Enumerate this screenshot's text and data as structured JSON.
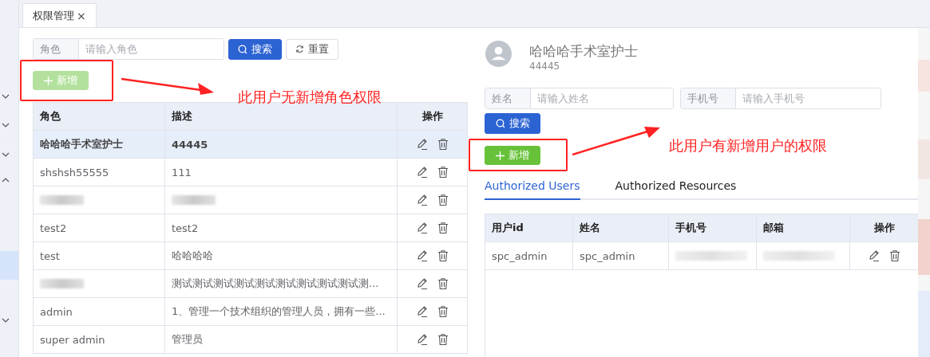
{
  "sidebar": {
    "items": [
      {
        "expanded": false
      },
      {
        "expanded": false
      },
      {
        "expanded": false
      },
      {
        "expanded": true
      },
      {
        "expanded": false
      }
    ]
  },
  "tabs": [
    {
      "label": "权限管理",
      "close": "×",
      "selected": true
    }
  ],
  "roles_panel": {
    "search": {
      "label": "角色",
      "placeholder": "请输入角色"
    },
    "search_button": "搜索",
    "reset_button": "重置",
    "add_button": {
      "label": "新增",
      "disabled": true
    },
    "table": {
      "columns": [
        "角色",
        "描述",
        "操作"
      ],
      "rows": [
        {
          "selected": true,
          "role": {
            "kind": "text",
            "text": "哈哈哈手术室护士"
          },
          "description": {
            "kind": "text",
            "text": "44445"
          }
        },
        {
          "selected": false,
          "role": {
            "kind": "text",
            "text": "shshsh55555"
          },
          "description": {
            "kind": "text",
            "text": "111"
          }
        },
        {
          "selected": false,
          "role": {
            "kind": "blurred"
          },
          "description": {
            "kind": "blurred"
          }
        },
        {
          "selected": false,
          "role": {
            "kind": "text",
            "text": "test2"
          },
          "description": {
            "kind": "text",
            "text": "test2"
          }
        },
        {
          "selected": false,
          "role": {
            "kind": "text",
            "text": "test"
          },
          "description": {
            "kind": "text",
            "text": "哈哈哈哈"
          }
        },
        {
          "selected": false,
          "role": {
            "kind": "blurred"
          },
          "description": {
            "kind": "text",
            "text": "测试测试测试测试测试测试测试测试测试测..."
          }
        },
        {
          "selected": false,
          "role": {
            "kind": "text",
            "text": "admin"
          },
          "description": {
            "kind": "text",
            "text": "1、管理一个技术组织的管理人员，拥有一些..."
          }
        },
        {
          "selected": false,
          "role": {
            "kind": "text",
            "text": "super admin"
          },
          "description": {
            "kind": "text",
            "text": "管理员"
          }
        }
      ]
    }
  },
  "role_detail": {
    "name": "哈哈哈手术室护士",
    "description": "44445",
    "fields": [
      {
        "label": "姓名",
        "placeholder": "请输入姓名"
      },
      {
        "label": "手机号",
        "placeholder": "请输入手机号"
      }
    ],
    "search_button": "搜索",
    "add_button": {
      "label": "新增",
      "disabled": false
    },
    "tabs": [
      {
        "label": "Authorized Users",
        "selected": true
      },
      {
        "label": "Authorized Resources",
        "selected": false
      }
    ],
    "table": {
      "columns": [
        "用户id",
        "姓名",
        "手机号",
        "邮箱",
        "操作"
      ],
      "rows": [
        {
          "user_id": "spc_admin",
          "name": "spc_admin",
          "phone": {
            "kind": "blurred"
          },
          "email": {
            "kind": "blurred"
          }
        }
      ]
    }
  },
  "annotations": [
    {
      "text": "此用户无新增角色权限"
    },
    {
      "text": "此用户有新增用户的权限"
    }
  ]
}
